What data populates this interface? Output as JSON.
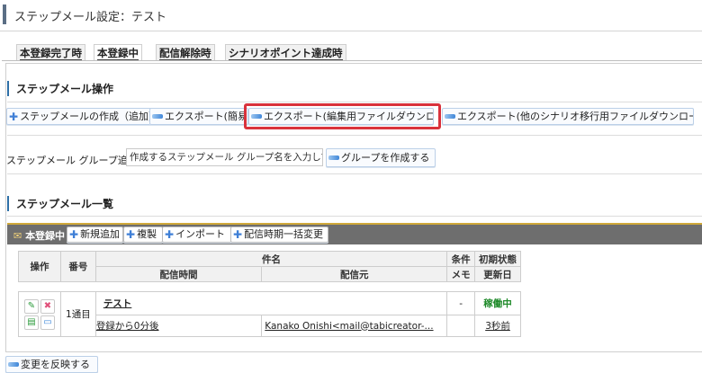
{
  "page": {
    "title": "ステップメール設定：テスト"
  },
  "tabs": [
    {
      "label": "本登録完了時"
    },
    {
      "label": "本登録中"
    },
    {
      "label": "配信解除時"
    },
    {
      "label": "シナリオポイント達成時"
    }
  ],
  "operations": {
    "title": "ステップメール操作",
    "buttons": [
      {
        "label": "ステップメールの作成（追加）"
      },
      {
        "label": "エクスポート(簡易)"
      },
      {
        "label": "エクスポート(編集用ファイルダウンロード)"
      },
      {
        "label": "エクスポート(他のシナリオ移行用ファイルダウンロード)"
      }
    ]
  },
  "group": {
    "label": "ステップメール グループ追加",
    "input_value": "作成するステップメール グループ名を入力してくだ",
    "create_label": "グループを作成する"
  },
  "list": {
    "title": "ステップメール一覧",
    "bar_title": "本登録中",
    "bar_buttons": [
      {
        "label": "新規追加"
      },
      {
        "label": "複製"
      },
      {
        "label": "インポート"
      },
      {
        "label": "配信時期一括変更"
      }
    ],
    "headers": {
      "operation": "操作",
      "number": "番号",
      "subject": "件名",
      "delivery_time": "配信時間",
      "sender": "配信元",
      "condition": "条件",
      "memo": "メモ",
      "initial_status": "初期状態",
      "updated": "更新日"
    },
    "rows": [
      {
        "number": "1通目",
        "subject": "テスト",
        "delivery_time": "登録から0分後",
        "sender": "Kanako Onishi<mail@tabicreator-...",
        "condition": "-",
        "status": "稼働中",
        "updated": "3秒前"
      }
    ]
  },
  "footer": {
    "reflect_label": "変更を反映する"
  },
  "colors": {
    "highlight": "#d9323c",
    "active_status": "#1f8a2a",
    "list_bar": "#6e6e6e"
  }
}
